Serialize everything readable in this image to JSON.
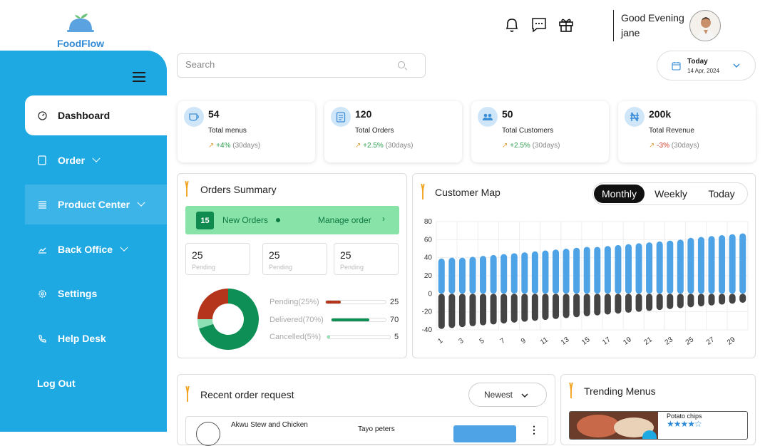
{
  "brand": {
    "name": "FoodFlow",
    "color": "#2f8bd6"
  },
  "sidebar": {
    "bg": "#1fa9e3",
    "items": [
      {
        "label": "Dashboard",
        "icon": "dashboard-icon"
      },
      {
        "label": "Order",
        "icon": "order-icon"
      },
      {
        "label": "Product Center",
        "icon": "product-icon"
      },
      {
        "label": "Back Office",
        "icon": "chart-icon"
      },
      {
        "label": "Settings",
        "icon": "gear-icon"
      },
      {
        "label": "Help Desk",
        "icon": "phone-icon"
      }
    ],
    "logout": "Log Out"
  },
  "header": {
    "search_placeholder": "Search",
    "greeting": "Good Evening",
    "user": "jane",
    "date_label": "Today",
    "date_value": "14 Apr, 2024"
  },
  "stats": [
    {
      "value": "54",
      "label": "Total menus",
      "change": "+4%",
      "period": "(30days)",
      "trend": "up"
    },
    {
      "value": "120",
      "label": "Total Orders",
      "change": "+2.5%",
      "period": "(30days)",
      "trend": "up"
    },
    {
      "value": "50",
      "label": "Total Customers",
      "change": "+2.5%",
      "period": "(30days)",
      "trend": "up"
    },
    {
      "value": "200k",
      "label": "Total Revenue",
      "change": "-3%",
      "period": "(30days)",
      "trend": "down"
    }
  ],
  "orders_summary": {
    "title": "Orders Summary",
    "new_count": "15",
    "new_label": "New Orders",
    "manage": "Manage order",
    "boxes": [
      {
        "value": "25",
        "label": "Pending"
      },
      {
        "value": "25",
        "label": "Pending"
      },
      {
        "value": "25",
        "label": "Pending"
      }
    ],
    "legend": [
      {
        "label": "Pending(25%)",
        "value": "25",
        "pct": 25,
        "color": "#b5351c"
      },
      {
        "label": "Delivered(70%)",
        "value": "70",
        "pct": 70,
        "color": "#0e8f55"
      },
      {
        "label": "Cancelled(5%)",
        "value": "5",
        "pct": 5,
        "color": "#8de0b4"
      }
    ]
  },
  "customer_map": {
    "title": "Customer Map",
    "tabs": [
      "Monthly",
      "Weekly",
      "Today"
    ]
  },
  "chart_data": {
    "type": "bar",
    "x": [
      1,
      2,
      3,
      4,
      5,
      6,
      7,
      8,
      9,
      10,
      11,
      12,
      13,
      14,
      15,
      16,
      17,
      18,
      19,
      20,
      21,
      22,
      23,
      24,
      25,
      26,
      27,
      28,
      29,
      30
    ],
    "xticks": [
      "1",
      "3",
      "5",
      "7",
      "9",
      "11",
      "13",
      "15",
      "17",
      "19",
      "21",
      "23",
      "25",
      "27",
      "29"
    ],
    "ylim": [
      -40,
      80
    ],
    "yticks": [
      "80",
      "60",
      "40",
      "20",
      "0",
      "-20",
      "-40"
    ],
    "series": [
      {
        "color": "#4ea3e6",
        "values": [
          39,
          40,
          40,
          41,
          42,
          43,
          44,
          45,
          46,
          47,
          48,
          49,
          50,
          51,
          52,
          52,
          53,
          54,
          55,
          56,
          57,
          58,
          59,
          60,
          62,
          63,
          64,
          65,
          66,
          67
        ]
      },
      {
        "color": "#444444",
        "values": [
          -39,
          -38,
          -37,
          -36,
          -35,
          -34,
          -33,
          -32,
          -31,
          -30,
          -29,
          -28,
          -27,
          -26,
          -25,
          -24,
          -23,
          -22,
          -21,
          -20,
          -19,
          -18,
          -17,
          -16,
          -15,
          -14,
          -13,
          -12,
          -11,
          -10
        ]
      }
    ]
  },
  "recent": {
    "title": "Recent order request",
    "sort": "Newest",
    "row_item": "Akwu Stew and Chicken",
    "row_customer": "Tayo peters"
  },
  "trending": {
    "title": "Trending Menus",
    "item": "Potato chips",
    "stars": "★★★★☆"
  }
}
